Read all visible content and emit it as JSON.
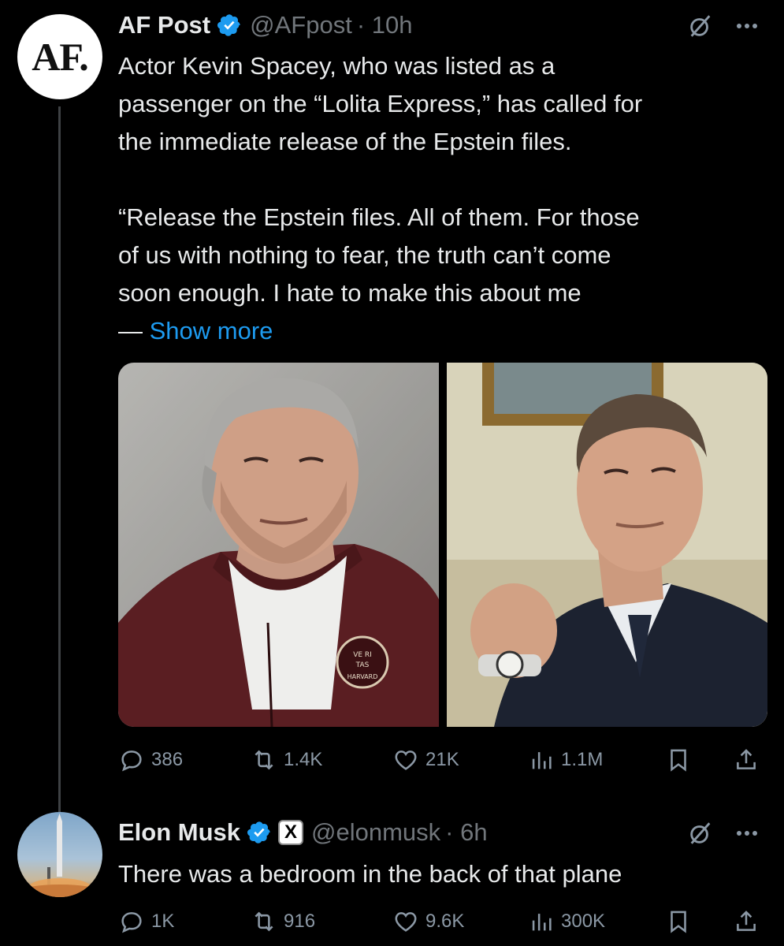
{
  "tweets": [
    {
      "name": "AF Post",
      "handle": "@AFpost",
      "time": "· 10h",
      "avatar_text": "AF.",
      "text": [
        "Actor Kevin Spacey, who was listed as a",
        "passenger on the “Lolita Express,” has called for",
        "the immediate release of the Epstein files.",
        "",
        "“Release the Epstein files. All of them. For those",
        "of us with nothing to fear, the truth can’t come",
        "soon enough. I hate to make this about me"
      ],
      "show_more_dash": "— ",
      "show_more": "Show more",
      "media_badge": [
        "VE RI",
        "TAS",
        "HARVARD"
      ],
      "stats": {
        "replies": "386",
        "reposts": "1.4K",
        "likes": "21K",
        "views": "1.1M"
      }
    },
    {
      "name": "Elon Musk",
      "handle": "@elonmusk",
      "time": "· 6h",
      "affiliate_badge": "X",
      "text": "There was a bedroom in the back of that plane",
      "stats": {
        "replies": "1K",
        "reposts": "916",
        "likes": "9.6K",
        "views": "300K"
      }
    }
  ],
  "colors": {
    "accent": "#1d9bf0",
    "muted": "#71767b",
    "background": "#000000"
  },
  "icons": [
    "verified-badge-icon",
    "grok-icon",
    "more-icon",
    "reply-icon",
    "repost-icon",
    "like-icon",
    "views-icon",
    "bookmark-icon",
    "share-icon"
  ]
}
